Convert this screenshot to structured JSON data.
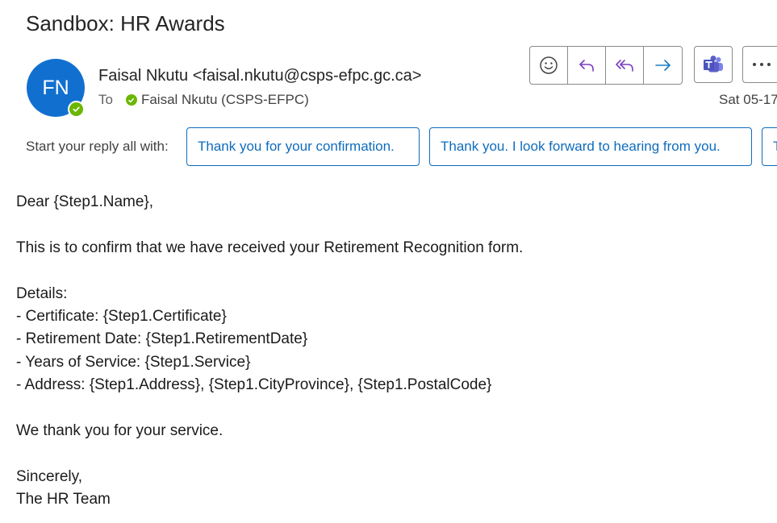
{
  "subject": "Sandbox: HR Awards",
  "sender": {
    "initials": "FN",
    "display": "Faisal Nkutu <faisal.nkutu@csps-efpc.gc.ca>",
    "to_label": "To",
    "recipient": "Faisal Nkutu  (CSPS-EFPC)",
    "date": "Sat 05-17"
  },
  "toolbar": {
    "icons": [
      "emoji-icon",
      "reply-icon",
      "reply-all-icon",
      "forward-icon",
      "teams-icon",
      "more-icon"
    ]
  },
  "suggested_replies": {
    "prompt": "Start your reply all with:",
    "items": [
      "Thank you for your confirmation.",
      "Thank you. I look forward to hearing from you.",
      "T"
    ]
  },
  "message": {
    "greeting": "Dear {Step1.Name},",
    "intro": "This is to confirm that we have received your Retirement Recognition form.",
    "details_heading": "Details:",
    "details": [
      "- Certificate: {Step1.Certificate}",
      "- Retirement Date: {Step1.RetirementDate}",
      "- Years of Service: {Step1.Service}",
      "- Address: {Step1.Address}, {Step1.CityProvince}, {Step1.PostalCode}"
    ],
    "thanks": "We thank you for your service.",
    "closing": "Sincerely,",
    "signature": "The HR Team"
  },
  "colors": {
    "accent": "#0f6cbd",
    "avatar": "#1170cf",
    "presence": "#6bb700",
    "reply_icons": "#7b3fbf",
    "teams": "#5b5fc7"
  }
}
